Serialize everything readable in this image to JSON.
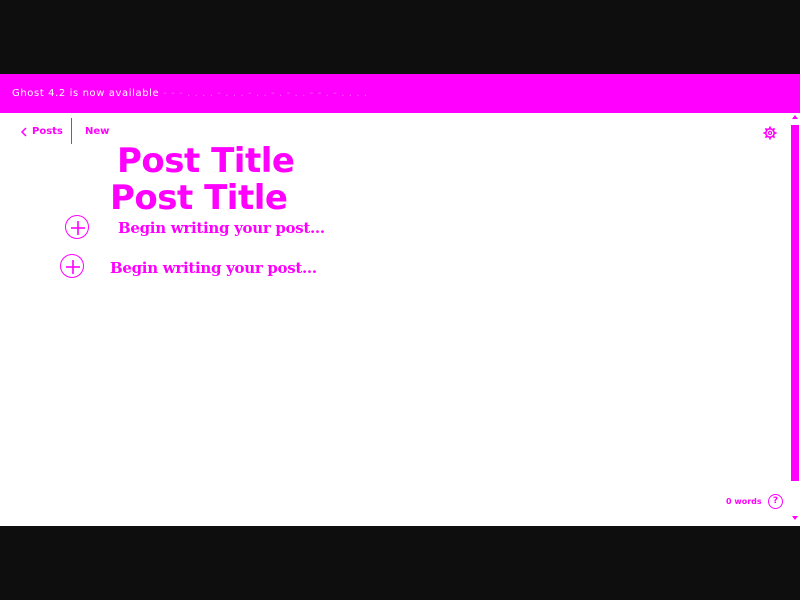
{
  "banner": {
    "message": "Ghost 4.2 is now available",
    "trailing": "- - - . . . . - . . . - . . - . - . . - - . - . . . ."
  },
  "topbar": {
    "back_label": "Posts",
    "status_label": "New"
  },
  "editor": {
    "title_placeholder": "Post Title",
    "body_placeholder": "Begin writing your post..."
  },
  "footer": {
    "word_count": "0 words",
    "help_label": "?"
  },
  "colors": {
    "accent": "#ff00ff",
    "background": "#ffffff",
    "letterbox": "#0e0e0e"
  },
  "icons": {
    "back": "chevron-left-icon",
    "settings": "gear-icon",
    "add_card": "plus-circle-icon",
    "help": "help-circle-icon"
  }
}
